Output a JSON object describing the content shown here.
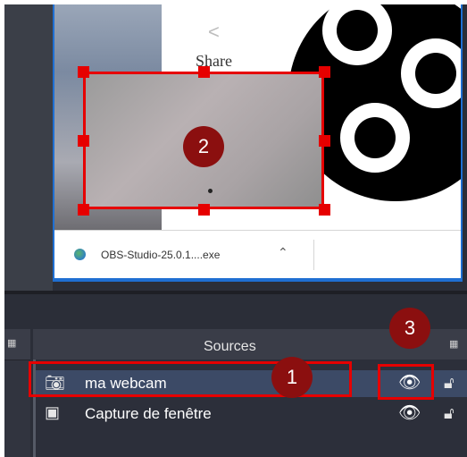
{
  "browser_preview": {
    "share_label": "Share",
    "download_filename": "OBS-Studio-25.0.1....exe",
    "icons": [
      "share-icon",
      "globe-icon",
      "chevron-up-icon"
    ]
  },
  "annotations": {
    "badge_1": "1",
    "badge_2": "2",
    "badge_3": "3",
    "accent_color": "#e60000",
    "badge_color": "#8b0f0f"
  },
  "sources_dock": {
    "title": "Sources",
    "items": [
      {
        "label": "ma webcam",
        "icon": "camera-icon",
        "visible": true,
        "locked": false,
        "selected": true
      },
      {
        "label": "Capture de fenêtre",
        "icon": "window-icon",
        "visible": true,
        "locked": false,
        "selected": false
      }
    ]
  },
  "theme": {
    "dock_bg": "#31343f",
    "selected_row": "#3c4a66",
    "preview_border": "#1f6fd2"
  }
}
